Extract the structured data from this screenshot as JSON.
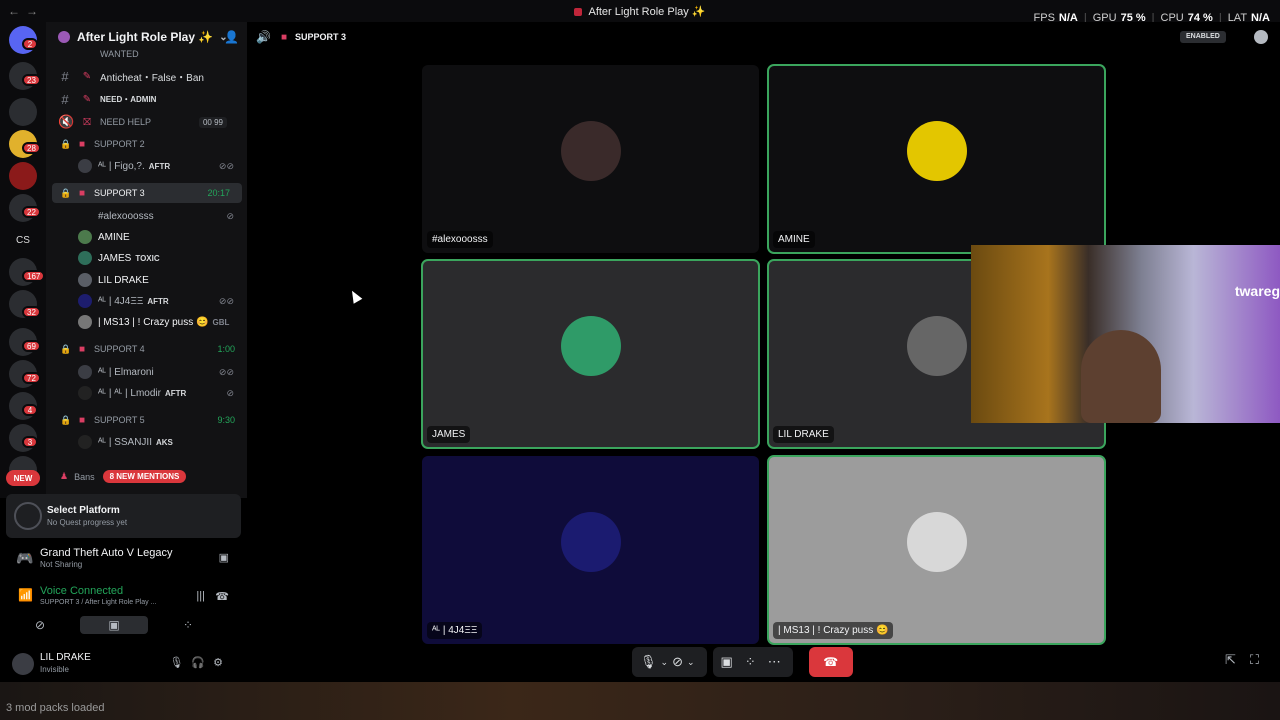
{
  "window": {
    "title": "After Light Role Play ✨",
    "stats": {
      "fps_label": "FPS",
      "fps": "N/A",
      "gpu_label": "GPU",
      "gpu": "75 %",
      "cpu_label": "CPU",
      "cpu": "74 %",
      "lat_label": "LAT",
      "lat": "N/A"
    }
  },
  "guilds": {
    "badges": [
      "2",
      "23",
      "28",
      "22",
      "CS",
      "167",
      "32",
      "69",
      "72",
      "4",
      "3"
    ],
    "new_label": "NEW"
  },
  "server": {
    "name": "After Light Role Play ✨",
    "channels": [
      {
        "name": "WANTED"
      },
      {
        "name": "Anticheat・False・Ban"
      },
      {
        "name": "NEED・ADMIN"
      },
      {
        "name": "NEED HELP",
        "count_a": "00",
        "count_b": "99"
      },
      {
        "name": "SUPPORT 2"
      },
      {
        "name": "SUPPORT 3",
        "time": "20:17"
      },
      {
        "name": "SUPPORT 4",
        "time": "1:00"
      },
      {
        "name": "SUPPORT 5",
        "time": "9:30"
      }
    ],
    "users": {
      "s2": [
        {
          "name": "ᴬᴸ | Figo,?.",
          "tag": "AFTR"
        }
      ],
      "s3": [
        {
          "name": "#alexooosss"
        },
        {
          "name": "AMINE"
        },
        {
          "name": "JAMES",
          "tag": "TOXIC"
        },
        {
          "name": "LIL DRAKE"
        },
        {
          "name": "ᴬᴸ | 4J4ΞΞ",
          "tag": "AFTR"
        },
        {
          "name": "| MS13 | ! Crazy puss 😊",
          "tag": "GBL"
        }
      ],
      "s4": [
        {
          "name": "ᴬᴸ | Elmaroni"
        },
        {
          "name": "ᴬᴸ | ᴬᴸ | Lmodir",
          "tag": "AFTR"
        }
      ],
      "s5": [
        {
          "name": "ᴬᴸ | SSANJII",
          "tag": "AKS"
        }
      ]
    },
    "bans": {
      "label": "Bans",
      "mentions": "8 NEW MENTIONS"
    }
  },
  "quest": {
    "title": "Select Platform",
    "sub": "No Quest progress yet"
  },
  "game": {
    "title": "Grand Theft Auto V Legacy",
    "sub": "Not Sharing"
  },
  "voice": {
    "status": "Voice Connected",
    "location": "SUPPORT 3 / After Light Role Play ..."
  },
  "me": {
    "name": "LIL DRAKE",
    "status": "Invisible"
  },
  "stage": {
    "channel": "SUPPORT 3",
    "enabled": "ENABLED",
    "tiles": [
      "#alexooosss",
      "AMINE",
      "JAMES",
      "LIL DRAKE",
      "ᴬᴸ | 4J4ΞΞ",
      "| MS13 | ! Crazy puss 😊"
    ],
    "webcam_brand": "twareg"
  },
  "footer": {
    "mods": "3 mod packs loaded"
  }
}
